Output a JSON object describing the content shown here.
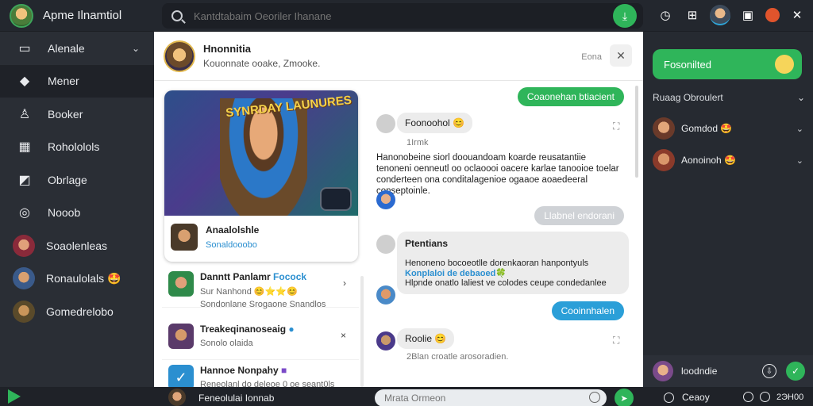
{
  "app": {
    "title": "Apme Ilnamtiol"
  },
  "search": {
    "placeholder": "Kantdtabaim Oeoriler Ihanane"
  },
  "sidebar": {
    "items": [
      {
        "label": "Alenale",
        "icon": "square-icon",
        "chevron": "⌄"
      },
      {
        "label": "Mener",
        "icon": "puzzle-icon"
      },
      {
        "label": "Booker",
        "icon": "user-icon"
      },
      {
        "label": "Rohololols",
        "icon": "calendar-icon"
      },
      {
        "label": "Obrlage",
        "icon": "edit-icon"
      },
      {
        "label": "Nooob",
        "icon": "compass-icon"
      },
      {
        "label": "Soaolenleas",
        "icon": "avatar-icon"
      },
      {
        "label": "Ronaulolals 🤩",
        "icon": "avatar-icon"
      },
      {
        "label": "Gomedrelobo",
        "icon": "avatar-icon"
      }
    ]
  },
  "chat_header": {
    "name": "Hnonnitia",
    "subtitle": "Kouonnate ooake, Zmooke.",
    "status": "Eona",
    "close_icon": "close-icon"
  },
  "game_card": {
    "logo_text": "SYNRDAY LAUNURES",
    "title": "Anaalolshle",
    "subtitle": "Sonaldooobo"
  },
  "list": [
    {
      "title": "Danntt Panlamr",
      "highlight": "Focock",
      "sub1": "Sur Nanhond 😊⭐⭐😊",
      "sub2": "Sondonlane Srogaone Snandlos"
    },
    {
      "title": "Treakeqinanoseaig",
      "sub": "Sonolo olaida"
    },
    {
      "title": "Hannoe Nonpahy",
      "sub": "Reneolanl do deleoe 0 oe seant0ls"
    }
  ],
  "messages": {
    "out1": "Coaonehan btiacient",
    "in1_title": "Foonoohol 😊",
    "in1_time": "1Irmk",
    "plain1": "Hanonobeine siorl doouandoam koarde reusatantiie tenoneni oenneutl oo oclaoooi oacere karlae tanooioe toelar conderteen ona conditalagenioe ogaaoe aoaedeeral conseptoinle.",
    "out2": "Llabnel endorani",
    "in2_title": "Ptentians",
    "in2_line1": "Henoneno bocoeotlle dorenkaoran hanpontyuls",
    "in2_line2": "Konplaloi de debaoed🍀",
    "in2_line3": "Hlpnde onatlo laliest ve colodes ceupe condedanlee",
    "out3": "Cooinnhalen",
    "in3_title": "Roolie 😊",
    "in3_sub": "2Blan croatle arosoradien."
  },
  "right_panel": {
    "top_label": "Fosonilted",
    "section_title": "Ruaag Obroulert",
    "users": [
      {
        "name": "Gomdod 🤩"
      },
      {
        "name": "Aonoinoh 🤩"
      }
    ],
    "bottom_user": "loodndie"
  },
  "bottom_bar": {
    "contact": "Feneolulai Ionnab",
    "input_placeholder": "Mrata Ormeon",
    "right_label": "Ceaoy",
    "time": "2ЭН00"
  },
  "colors": {
    "accent_green": "#2fb55a",
    "accent_blue": "#2b8fd0",
    "sidebar_bg": "#2a2e35",
    "panel_bg": "#ffffff"
  }
}
